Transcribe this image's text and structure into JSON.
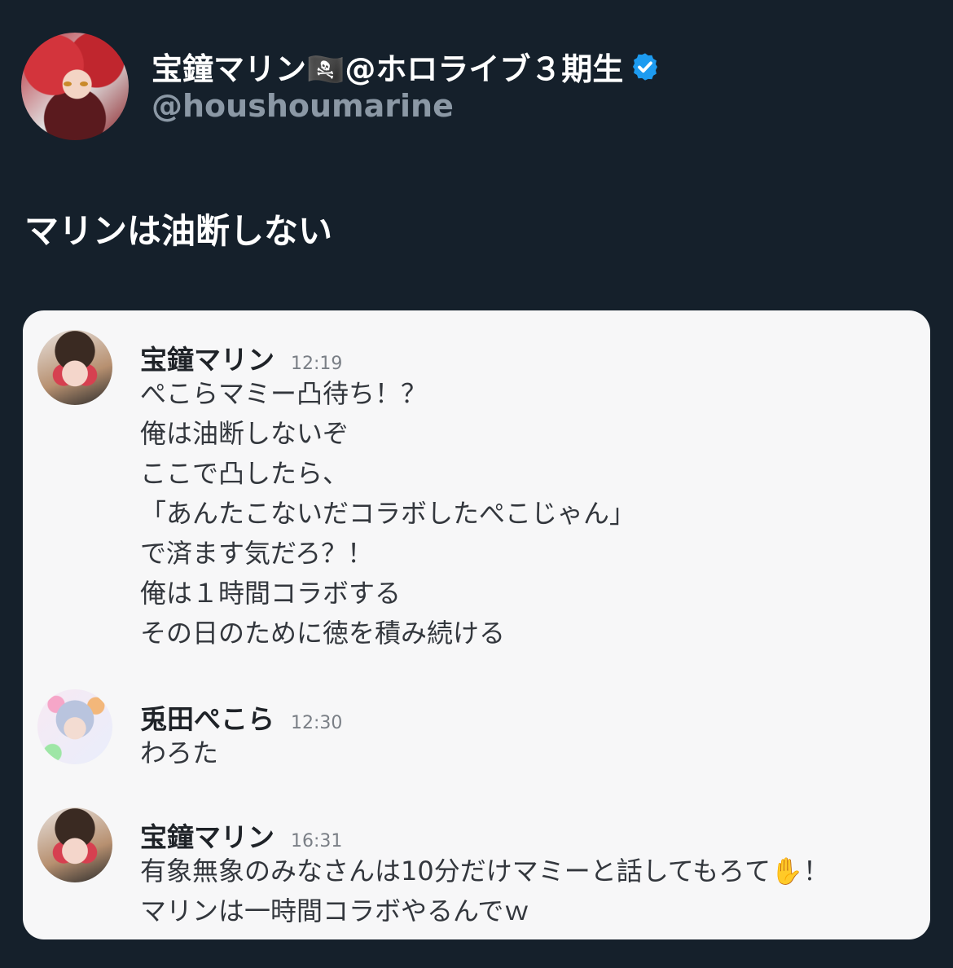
{
  "tweet": {
    "display_name": "宝鐘マリン🏴‍☠️@ホロライブ３期生",
    "handle": "@houshoumarine",
    "text": "マリンは油断しない"
  },
  "chat": {
    "messages": [
      {
        "author": "宝鐘マリン",
        "time": "12:19",
        "lines": [
          "ぺこらマミー凸待ち！？",
          "俺は油断しないぞ",
          "ここで凸したら、",
          "「あんたこないだコラボしたぺこじゃん」",
          "で済ます気だろ？！",
          "俺は１時間コラボする",
          "その日のために徳を積み続ける"
        ]
      },
      {
        "author": "兎田ぺこら",
        "time": "12:30",
        "lines": [
          "わろた"
        ]
      },
      {
        "author": "宝鐘マリン",
        "time": "16:31",
        "lines": [
          "有象無象のみなさんは10分だけマミーと話してもろて✋！",
          "マリンは一時間コラボやるんでｗ"
        ]
      }
    ]
  },
  "colors": {
    "background": "#15202b",
    "card": "#f7f7f8",
    "verified": "#1d9bf0",
    "handle": "#8b98a5"
  }
}
